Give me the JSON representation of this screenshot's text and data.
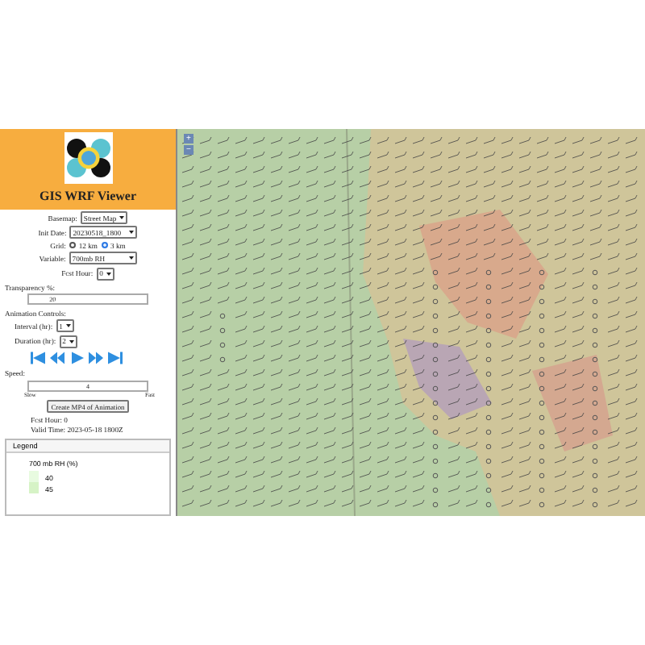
{
  "header": {
    "title": "GIS WRF Viewer"
  },
  "controls": [
    {
      "kind": "select",
      "label": "Basemap:",
      "value": "Street Map"
    },
    {
      "kind": "select",
      "label": "Init Date:",
      "value": "20230518_1800"
    },
    {
      "kind": "radio",
      "label": "Grid:",
      "options": [
        {
          "label": "12 km",
          "selected": false
        },
        {
          "label": "3 km",
          "selected": true
        }
      ]
    },
    {
      "kind": "select",
      "label": "Variable:",
      "value": "700mb RH"
    },
    {
      "kind": "select",
      "label": "Fcst Hour:",
      "value": "0"
    }
  ],
  "transparency": {
    "label": "Transparency %:",
    "value": "20",
    "level": 0.2
  },
  "animation": {
    "heading": "Animation Controls:",
    "selects": [
      {
        "label": "Interval (hr):",
        "value": "1"
      },
      {
        "label": "Duration (hr):",
        "value": "2"
      }
    ]
  },
  "speed": {
    "label": "Speed:",
    "value": "4",
    "level": 0.5,
    "min_label": "Slow",
    "max_label": "Fast"
  },
  "create_button": "Create MP4 of Animation",
  "status": [
    "Fcst Hour: 0",
    "Valid Time: 2023-05-18 1800Z"
  ],
  "legend": {
    "heading": "Legend",
    "title": "700 mb RH (%)",
    "entries": [
      {
        "label": "40",
        "color": "#e8fbe0"
      },
      {
        "label": "45",
        "color": "#d6f3c6"
      }
    ]
  },
  "map": {
    "zoom_in": "+",
    "zoom_out": "−"
  }
}
